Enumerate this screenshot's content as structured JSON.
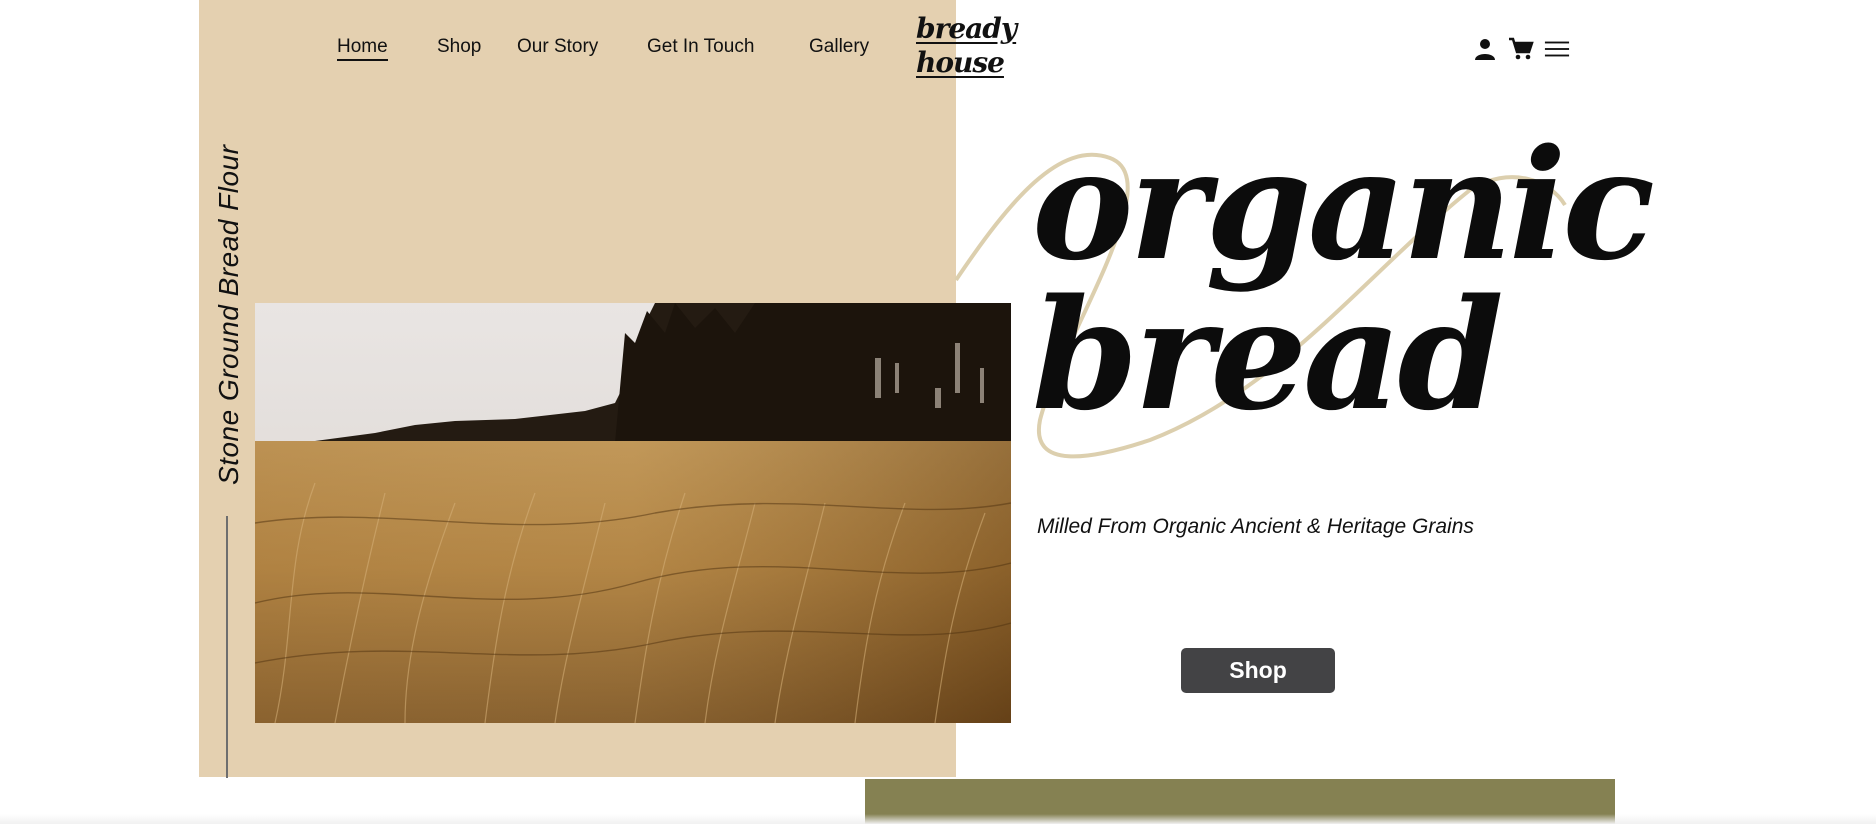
{
  "nav": {
    "items": [
      {
        "label": "Home",
        "active": true
      },
      {
        "label": "Shop",
        "active": false
      },
      {
        "label": "Our Story",
        "active": false
      },
      {
        "label": "Get In Touch",
        "active": false
      },
      {
        "label": "Gallery",
        "active": false
      }
    ]
  },
  "logo": {
    "line1": "bready",
    "line2": "house"
  },
  "header_icons": [
    "user-icon",
    "cart-icon",
    "menu-icon"
  ],
  "side": {
    "vertical_text": "Stone Ground Bread Flour"
  },
  "hero": {
    "title_line1": "organic",
    "title_line2": "bread",
    "subtitle": "Milled From Organic Ancient & Heritage Grains",
    "cta_label": "Shop",
    "image_description_icon": "wheat-field-photo"
  },
  "colors": {
    "beige": "#e4d0b0",
    "olive": "#858152",
    "button": "#434345",
    "swirl": "#dccfae"
  }
}
